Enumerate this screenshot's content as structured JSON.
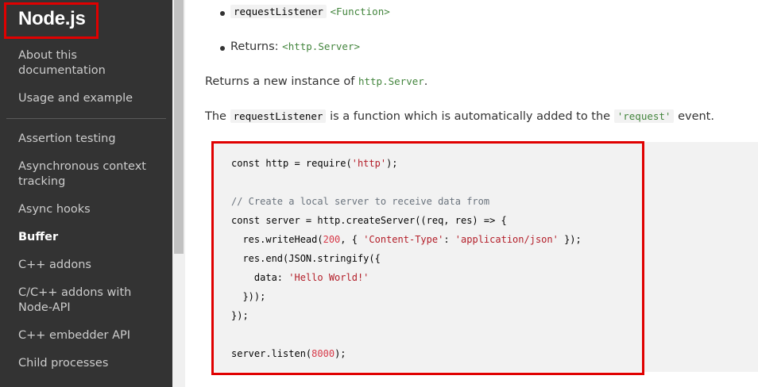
{
  "sidebar": {
    "logo": "Node.js",
    "items": [
      {
        "label": "About this",
        "label2": "documentation"
      },
      {
        "label": "Usage and example"
      },
      {
        "label": "Assertion testing"
      },
      {
        "label": "Asynchronous context",
        "label2": "tracking"
      },
      {
        "label": "Async hooks"
      },
      {
        "label": "Buffer",
        "active": true
      },
      {
        "label": "C++ addons"
      },
      {
        "label": "C/C++ addons with",
        "label2": "Node-API"
      },
      {
        "label": "C++ embedder API"
      },
      {
        "label": "Child processes"
      }
    ]
  },
  "main": {
    "bullets": [
      {
        "code": "requestListener",
        "type": "<Function>"
      },
      {
        "text": "Returns:",
        "type": "<http.Server>"
      }
    ],
    "para1": {
      "before": "Returns a new instance of",
      "code": "http.Server",
      "after": "."
    },
    "para2": {
      "before": "The",
      "code": "requestListener",
      "middle": "is a function which is automatically added to the",
      "code2": "'request'",
      "after": "event."
    },
    "code_lines": [
      "const http = require(",
      "'http'",
      ");",
      "// Create a local server to receive data from",
      "const server = http.createServer((req, res) => {",
      "  res.writeHead(",
      "200",
      ", { ",
      "'Content-Type'",
      ": ",
      "'application/json'",
      " });",
      "  res.end(JSON.stringify({",
      "    data: ",
      "'Hello World!'",
      "  }));",
      "});",
      "server.listen(",
      "8000",
      ");"
    ]
  }
}
